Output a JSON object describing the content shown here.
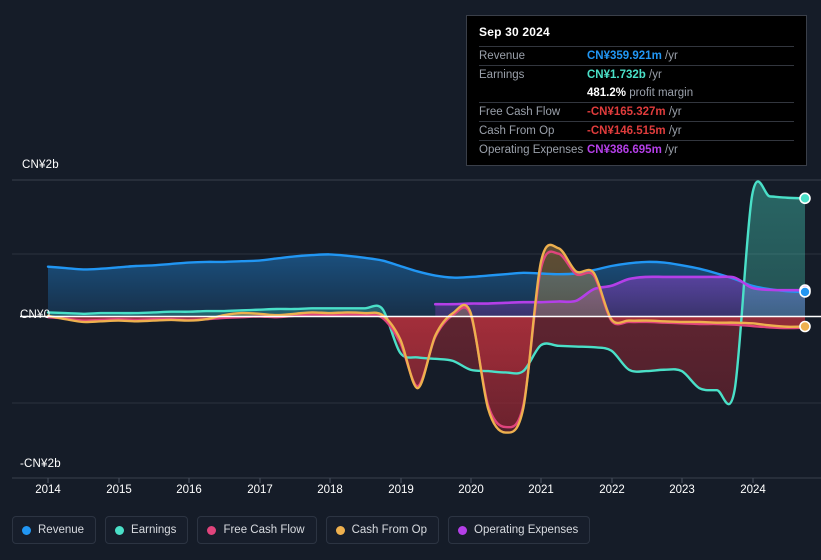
{
  "axes": {
    "y_top_label": "CN¥2b",
    "y_zero_label": "CN¥0",
    "y_bottom_label": "-CN¥2b",
    "x_ticks": [
      "2014",
      "2015",
      "2016",
      "2017",
      "2018",
      "2019",
      "2020",
      "2021",
      "2022",
      "2023",
      "2024"
    ]
  },
  "tooltip": {
    "title": "Sep 30 2024",
    "rows": [
      {
        "label": "Revenue",
        "value": "CN¥359.921m",
        "unit": "/yr",
        "color": "#2196f3"
      },
      {
        "label": "Earnings",
        "value": "CN¥1.732b",
        "unit": "/yr",
        "color": "#4ae0c8"
      },
      {
        "label": "",
        "value": "481.2%",
        "unit": "profit margin",
        "color": "#ffffff"
      },
      {
        "label": "Free Cash Flow",
        "value": "-CN¥165.327m",
        "unit": "/yr",
        "color": "#e03c3c"
      },
      {
        "label": "Cash From Op",
        "value": "-CN¥146.515m",
        "unit": "/yr",
        "color": "#e03c3c"
      },
      {
        "label": "Operating Expenses",
        "value": "CN¥386.695m",
        "unit": "/yr",
        "color": "#b43fe8"
      }
    ]
  },
  "legend": {
    "items": [
      {
        "label": "Revenue",
        "color": "#2196f3"
      },
      {
        "label": "Earnings",
        "color": "#4ae0c8"
      },
      {
        "label": "Free Cash Flow",
        "color": "#e0447c"
      },
      {
        "label": "Cash From Op",
        "color": "#eeb04e"
      },
      {
        "label": "Operating Expenses",
        "color": "#b43fe8"
      }
    ]
  },
  "chart_data": {
    "type": "area",
    "title": "",
    "xlabel": "",
    "ylabel": "CN¥",
    "ylim": [
      -2.0,
      2.0
    ],
    "grid": true,
    "legend_position": "bottom",
    "currency": "CN¥",
    "units": "billions",
    "x": [
      2014.0,
      2014.25,
      2014.5,
      2014.75,
      2015.0,
      2015.25,
      2015.5,
      2015.75,
      2016.0,
      2016.25,
      2016.5,
      2016.75,
      2017.0,
      2017.25,
      2017.5,
      2017.75,
      2018.0,
      2018.25,
      2018.5,
      2018.75,
      2019.0,
      2019.25,
      2019.5,
      2019.75,
      2020.0,
      2020.25,
      2020.5,
      2020.75,
      2021.0,
      2021.25,
      2021.5,
      2021.75,
      2022.0,
      2022.25,
      2022.5,
      2022.75,
      2023.0,
      2023.25,
      2023.5,
      2023.75,
      2024.0,
      2024.25,
      2024.5,
      2024.75
    ],
    "series": [
      {
        "name": "Revenue",
        "color": "#2196f3",
        "values": [
          0.73,
          0.71,
          0.69,
          0.7,
          0.72,
          0.74,
          0.75,
          0.77,
          0.79,
          0.8,
          0.8,
          0.81,
          0.82,
          0.85,
          0.88,
          0.9,
          0.91,
          0.89,
          0.86,
          0.82,
          0.74,
          0.66,
          0.6,
          0.57,
          0.58,
          0.6,
          0.62,
          0.64,
          0.63,
          0.62,
          0.63,
          0.68,
          0.74,
          0.78,
          0.8,
          0.79,
          0.75,
          0.7,
          0.63,
          0.55,
          0.45,
          0.4,
          0.37,
          0.36
        ]
      },
      {
        "name": "Earnings",
        "color": "#4ae0c8",
        "values": [
          0.06,
          0.05,
          0.04,
          0.05,
          0.05,
          0.05,
          0.06,
          0.07,
          0.07,
          0.08,
          0.08,
          0.09,
          0.1,
          0.11,
          0.11,
          0.12,
          0.12,
          0.12,
          0.12,
          0.11,
          -0.53,
          -0.6,
          -0.62,
          -0.65,
          -0.78,
          -0.8,
          -0.82,
          -0.8,
          -0.42,
          -0.43,
          -0.44,
          -0.45,
          -0.5,
          -0.78,
          -0.8,
          -0.78,
          -0.8,
          -1.05,
          -1.08,
          -1.08,
          1.78,
          1.76,
          1.74,
          1.73
        ]
      },
      {
        "name": "Free Cash Flow",
        "color": "#e0447c",
        "values": [
          -0.01,
          -0.03,
          -0.06,
          -0.05,
          -0.04,
          -0.05,
          -0.04,
          -0.04,
          -0.05,
          -0.04,
          -0.02,
          -0.01,
          0.0,
          -0.01,
          0.01,
          0.03,
          0.02,
          0.03,
          0.02,
          -0.02,
          -0.38,
          -1.02,
          -0.3,
          0.02,
          0.03,
          -1.3,
          -1.62,
          -1.3,
          0.7,
          0.92,
          0.62,
          0.6,
          -0.06,
          -0.08,
          -0.08,
          -0.09,
          -0.1,
          -0.11,
          -0.11,
          -0.12,
          -0.14,
          -0.16,
          -0.17,
          -0.165
        ]
      },
      {
        "name": "Cash From Op",
        "color": "#eeb04e",
        "values": [
          0.01,
          -0.04,
          -0.08,
          -0.07,
          -0.06,
          -0.07,
          -0.06,
          -0.05,
          -0.06,
          -0.04,
          0.02,
          0.05,
          0.04,
          0.02,
          0.04,
          0.06,
          0.05,
          0.06,
          0.05,
          0.02,
          -0.33,
          -1.05,
          -0.28,
          0.05,
          0.06,
          -1.35,
          -1.7,
          -1.34,
          0.8,
          1.0,
          0.66,
          0.64,
          -0.04,
          -0.06,
          -0.06,
          -0.07,
          -0.08,
          -0.08,
          -0.09,
          -0.09,
          -0.1,
          -0.13,
          -0.15,
          -0.1465
        ]
      },
      {
        "name": "Operating Expenses",
        "color": "#b43fe8",
        "values": [
          null,
          null,
          null,
          null,
          null,
          null,
          null,
          null,
          null,
          null,
          null,
          null,
          null,
          null,
          null,
          null,
          null,
          null,
          null,
          null,
          null,
          null,
          0.18,
          0.18,
          0.19,
          0.19,
          0.2,
          0.21,
          0.21,
          0.22,
          0.23,
          0.4,
          0.45,
          0.55,
          0.58,
          0.58,
          0.58,
          0.58,
          0.58,
          0.57,
          0.42,
          0.39,
          0.385,
          0.3867
        ]
      }
    ],
    "end_markers": [
      {
        "series": "Earnings",
        "value": 1.732,
        "color": "#4ae0c8"
      },
      {
        "series": "Operating Expenses",
        "value": 0.3867,
        "color": "#b43fe8"
      },
      {
        "series": "Revenue",
        "value": 0.3599,
        "color": "#2196f3"
      },
      {
        "series": "Cash From Op",
        "value": -0.1465,
        "color": "#eeb04e"
      }
    ]
  }
}
